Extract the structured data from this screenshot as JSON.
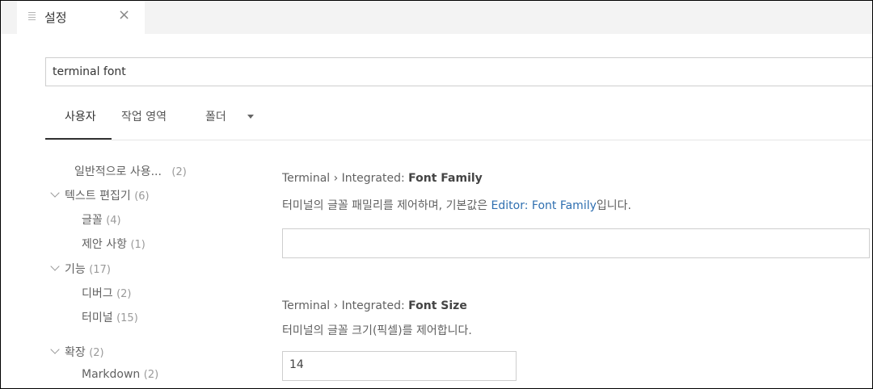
{
  "tab": {
    "title": "설정",
    "close": "×"
  },
  "search": {
    "value": "terminal font"
  },
  "scopes": {
    "user": "사용자",
    "workspace": "작업 영역",
    "folder": "폴더"
  },
  "toc": {
    "commonly_used": {
      "label": "일반적으로 사용...",
      "count": "(2)"
    },
    "text_editor": {
      "label": "텍스트 편집기",
      "count": "(6)"
    },
    "font": {
      "label": "글꼴",
      "count": "(4)"
    },
    "suggestions": {
      "label": "제안 사항",
      "count": "(1)"
    },
    "features": {
      "label": "기능",
      "count": "(17)"
    },
    "debug": {
      "label": "디버그",
      "count": "(2)"
    },
    "terminal": {
      "label": "터미널",
      "count": "(15)"
    },
    "extensions": {
      "label": "확장",
      "count": "(2)"
    },
    "markdown": {
      "label": "Markdown",
      "count": "(2)"
    }
  },
  "settings": {
    "font_family": {
      "category": "Terminal › Integrated: ",
      "name": "Font Family",
      "desc_before": "터미널의 글꼴 패밀리를 제어하며, 기본값은 ",
      "desc_link": "Editor: Font Family",
      "desc_after": "입니다.",
      "value": ""
    },
    "font_size": {
      "category": "Terminal › Integrated: ",
      "name": "Font Size",
      "desc": "터미널의 글꼴 크기(픽셀)를 제어합니다.",
      "value": "14"
    }
  }
}
